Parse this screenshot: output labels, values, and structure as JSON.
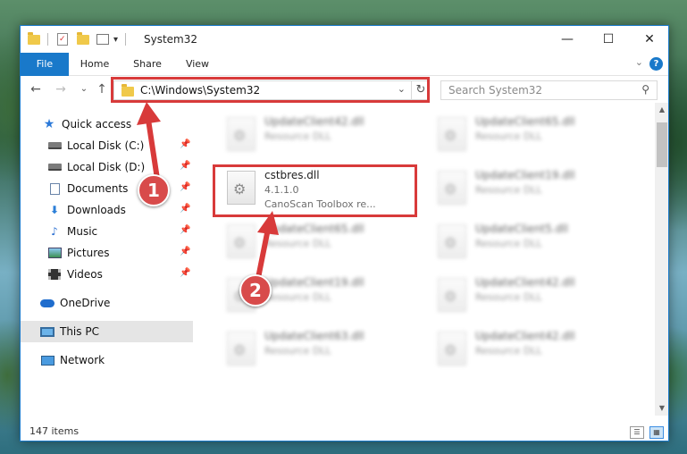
{
  "titlebar": {
    "title": "System32",
    "minimize": "—",
    "maximize": "☐",
    "close": "✕",
    "qa_dropdown": "▾"
  },
  "ribbon": {
    "tabs": [
      "File",
      "Home",
      "Share",
      "View"
    ],
    "help": "?",
    "collapse": "⌄"
  },
  "nav": {
    "back": "←",
    "forward": "→",
    "recent": "⌄",
    "up": "↑",
    "address": "C:\\Windows\\System32",
    "address_dropdown": "⌄",
    "refresh": "↻",
    "search_placeholder": "Search System32",
    "search_icon": "⚲"
  },
  "sidebar": {
    "items": [
      {
        "label": "Quick access",
        "icon": "star-icon"
      },
      {
        "label": "Local Disk (C:)",
        "icon": "drive-icon",
        "pinned": true
      },
      {
        "label": "Local Disk (D:)",
        "icon": "drive-icon",
        "pinned": true
      },
      {
        "label": "Documents",
        "icon": "documents-icon",
        "pinned": true
      },
      {
        "label": "Downloads",
        "icon": "downloads-icon",
        "pinned": true
      },
      {
        "label": "Music",
        "icon": "music-icon",
        "pinned": true
      },
      {
        "label": "Pictures",
        "icon": "pictures-icon",
        "pinned": true
      },
      {
        "label": "Videos",
        "icon": "videos-icon",
        "pinned": true
      },
      {
        "label": "OneDrive",
        "icon": "onedrive-icon"
      },
      {
        "label": "This PC",
        "icon": "this-pc-icon",
        "selected": true
      },
      {
        "label": "Network",
        "icon": "network-icon"
      }
    ],
    "pin_glyph": "📌"
  },
  "files": [
    {
      "name": "UpdateClient42.dll",
      "type": "Resource DLL",
      "blurred": true
    },
    {
      "name": "UpdateClient65.dll",
      "type": "Resource DLL",
      "blurred": true
    },
    {
      "name": "cstbres.dll",
      "type": "4.1.1.0",
      "desc": "CanoScan Toolbox re...",
      "blurred": false
    },
    {
      "name": "UpdateClient19.dll",
      "type": "Resource DLL",
      "blurred": true
    },
    {
      "name": "UpdateClient65.dll",
      "type": "Resource DLL",
      "blurred": true
    },
    {
      "name": "UpdateClient5.dll",
      "type": "Resource DLL",
      "blurred": true
    },
    {
      "name": "UpdateClient19.dll",
      "type": "Resource DLL",
      "blurred": true
    },
    {
      "name": "UpdateClient42.dll",
      "type": "Resource DLL",
      "blurred": true
    },
    {
      "name": "UpdateClient63.dll",
      "type": "Resource DLL",
      "blurred": true
    },
    {
      "name": "UpdateClient42.dll",
      "type": "Resource DLL",
      "blurred": true
    }
  ],
  "scroll": {
    "up": "▲",
    "down": "▼"
  },
  "status": {
    "count": "147 items",
    "details_view": "☰",
    "tiles_view": "▦"
  },
  "annotations": {
    "step1": "1",
    "step2": "2",
    "highlight_color": "#d83a3a",
    "accent_color": "#1979ca"
  }
}
